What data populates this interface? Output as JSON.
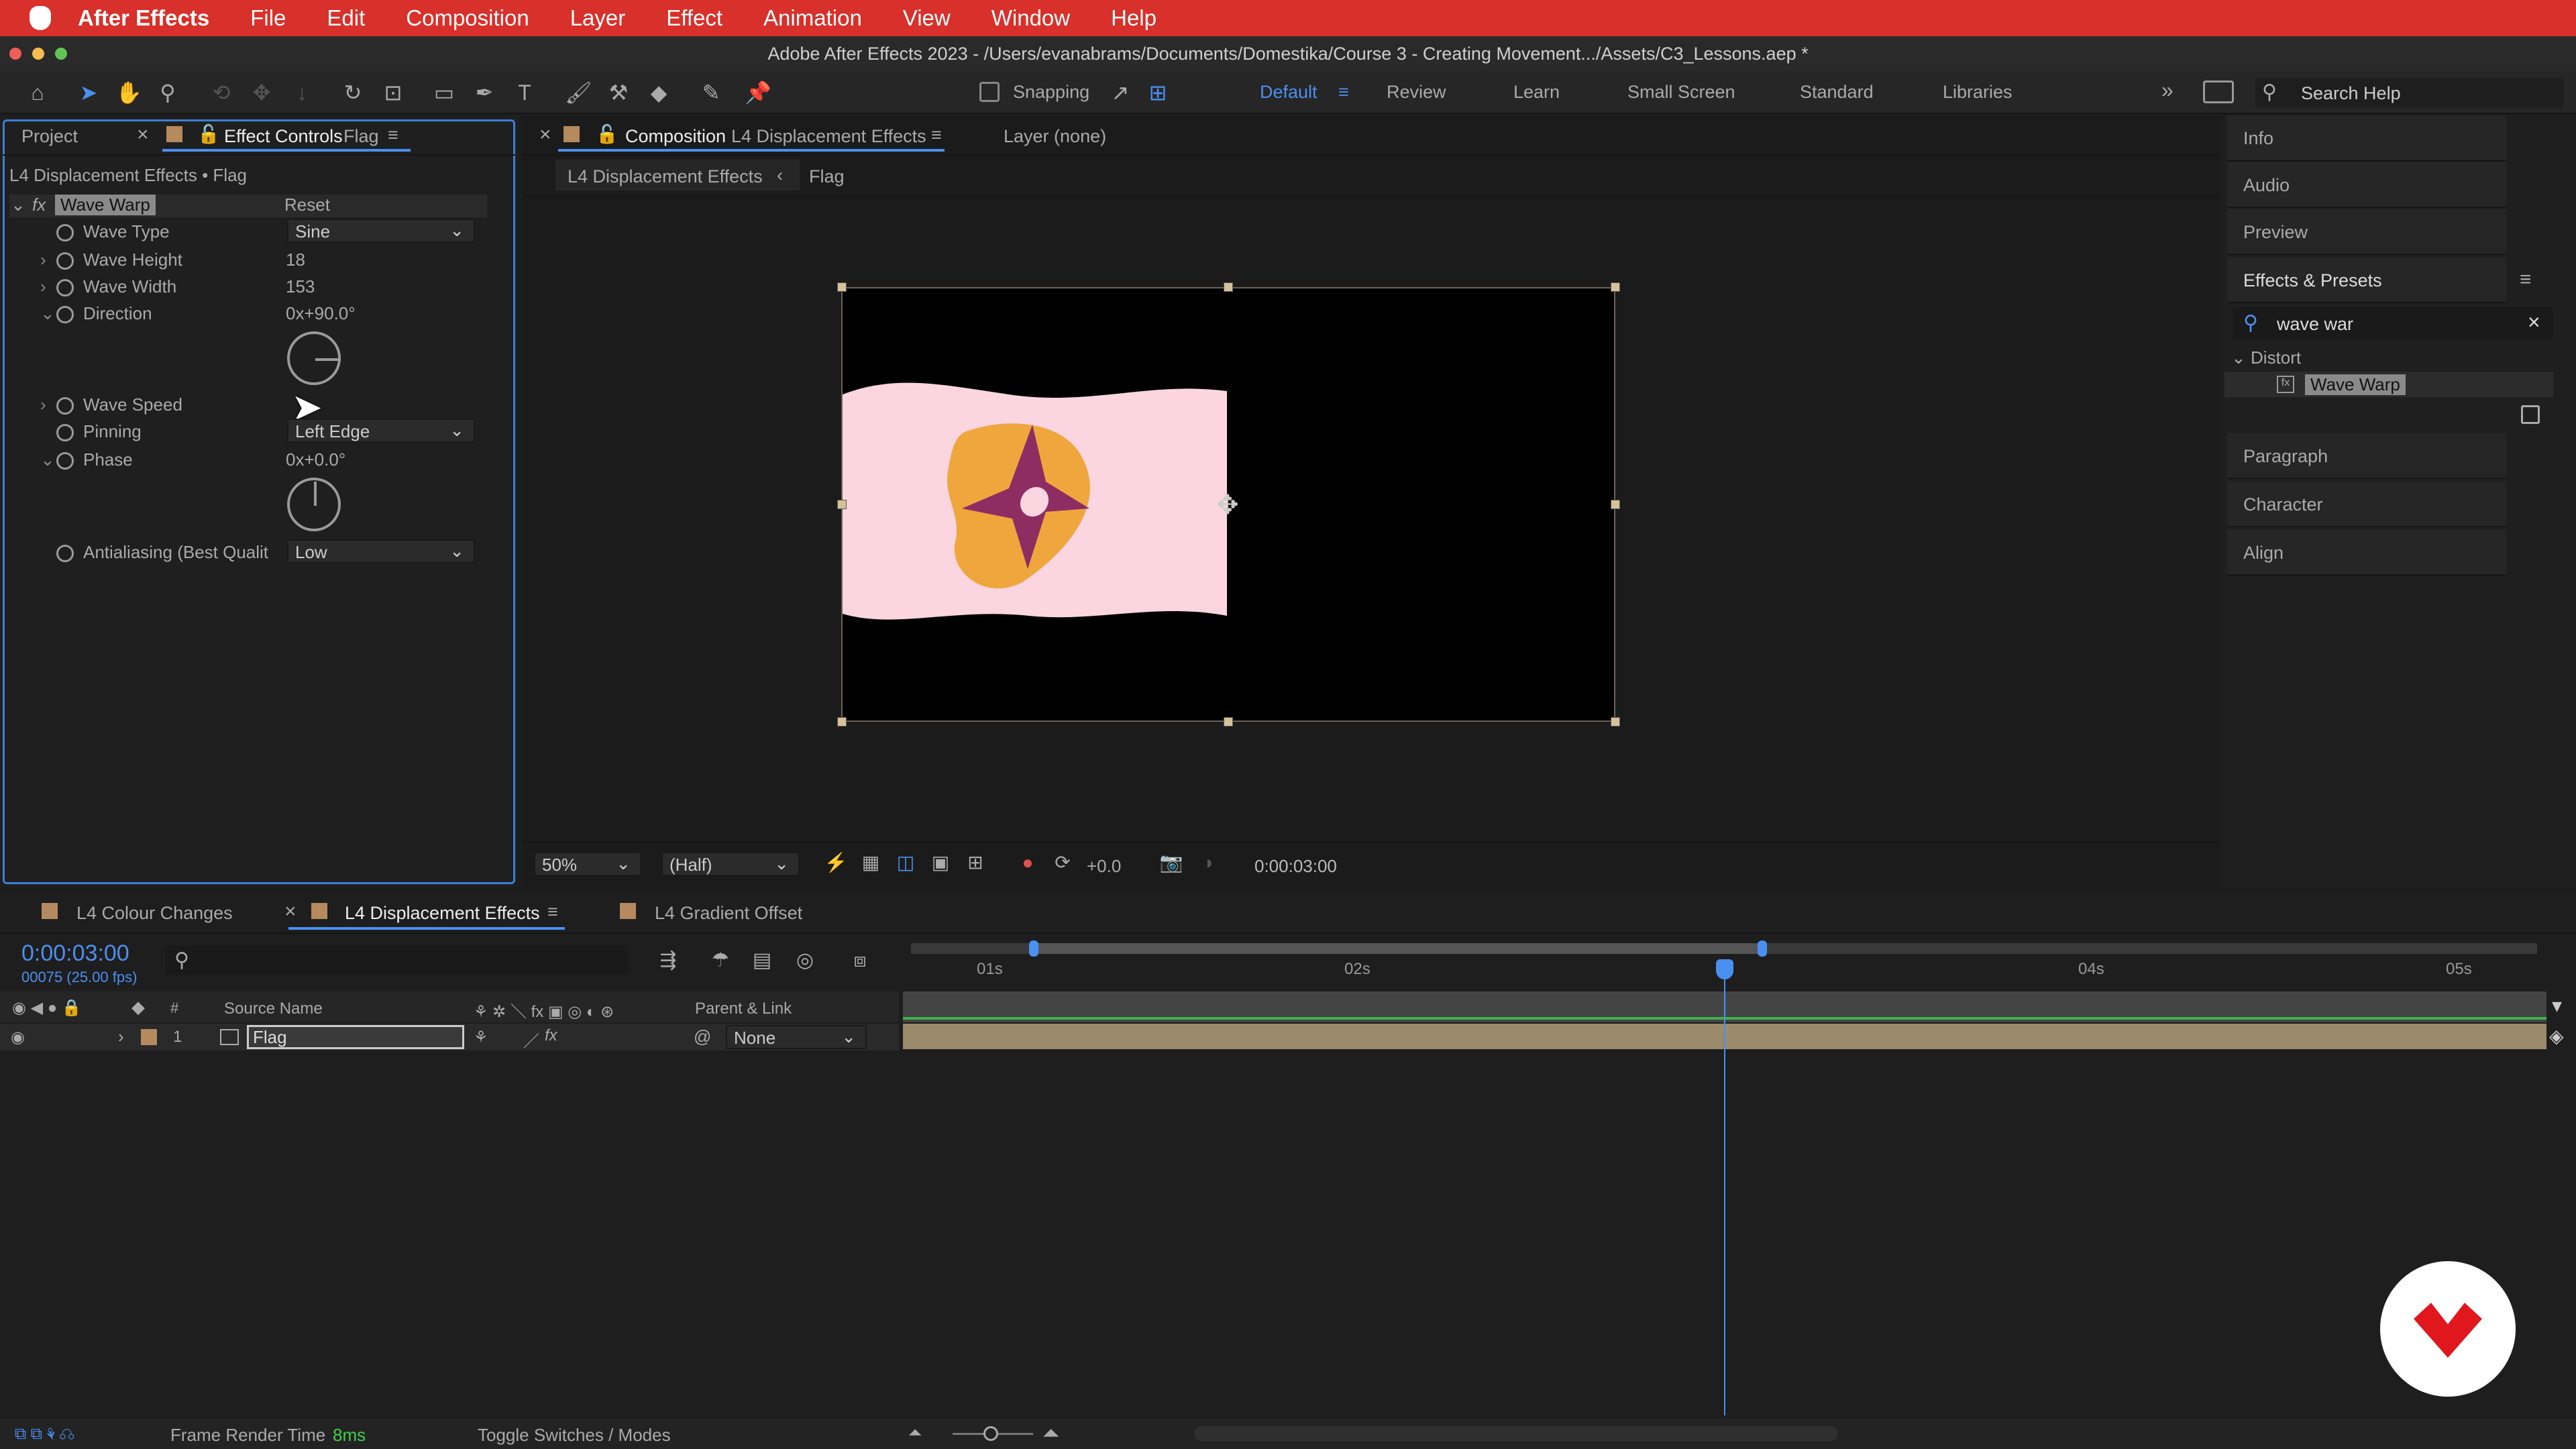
{
  "menubar": {
    "app": "After Effects",
    "items": [
      "File",
      "Edit",
      "Composition",
      "Layer",
      "Effect",
      "Animation",
      "View",
      "Window",
      "Help"
    ]
  },
  "window_title": "Adobe After Effects 2023 - /Users/evanabrams/Documents/Domestika/Course 3 - Creating Movement.../Assets/C3_Lessons.aep *",
  "toolbar": {
    "snapping": "Snapping",
    "workspaces": [
      "Default",
      "Review",
      "Learn",
      "Small Screen",
      "Standard",
      "Libraries"
    ],
    "search_placeholder": "Search Help"
  },
  "left_panel": {
    "tab_project": "Project",
    "tab_effect_controls": "Effect Controls",
    "tab_layer": "Flag",
    "breadcrumb": "L4 Displacement Effects • Flag",
    "fx_label": "fx",
    "effect_name": "Wave Warp",
    "reset": "Reset",
    "params": {
      "wave_type": {
        "label": "Wave Type",
        "value": "Sine"
      },
      "wave_height": {
        "label": "Wave Height",
        "value": "18"
      },
      "wave_width": {
        "label": "Wave Width",
        "value": "153"
      },
      "direction": {
        "label": "Direction",
        "value": "0x+90.0°"
      },
      "wave_speed": {
        "label": "Wave Speed"
      },
      "pinning": {
        "label": "Pinning",
        "value": "Left Edge"
      },
      "phase": {
        "label": "Phase",
        "value": "0x+0.0°"
      },
      "antialiasing": {
        "label": "Antialiasing (Best Qualit",
        "value": "Low"
      }
    }
  },
  "comp_panel": {
    "tab_prefix": "Composition",
    "tab_name": "L4 Displacement Effects",
    "layer_tab": "Layer (none)",
    "crumb_comp": "L4 Displacement Effects",
    "crumb_layer": "Flag",
    "zoom": "50%",
    "resolution": "(Half)",
    "exposure": "+0.0",
    "timecode": "0:00:03:00"
  },
  "right_panel": {
    "items_top": [
      "Info",
      "Audio",
      "Preview"
    ],
    "effects_presets": "Effects & Presets",
    "search_value": "wave war",
    "category": "Distort",
    "result": "Wave Warp",
    "items_bottom": [
      "Paragraph",
      "Character",
      "Align"
    ]
  },
  "timeline": {
    "tabs": [
      "L4 Colour Changes",
      "L4 Displacement Effects",
      "L4 Gradient Offset"
    ],
    "timecode": "0:00:03:00",
    "frames": "00075 (25.00 fps)",
    "col_num": "#",
    "col_source": "Source Name",
    "col_parent": "Parent & Link",
    "layer": {
      "number": "1",
      "name": "Flag",
      "parent": "None"
    },
    "ruler": [
      "01s",
      "02s",
      "04s",
      "05s"
    ],
    "render_label": "Frame Render Time",
    "render_value": "8ms",
    "toggle": "Toggle Switches / Modes"
  },
  "colors": {
    "accent": "#4a90f0",
    "menubar": "#d8302a",
    "flag": "#fbd5df",
    "sun": "#efa63d",
    "star": "#8e2d62",
    "layer_bar": "#9b8a6b"
  }
}
